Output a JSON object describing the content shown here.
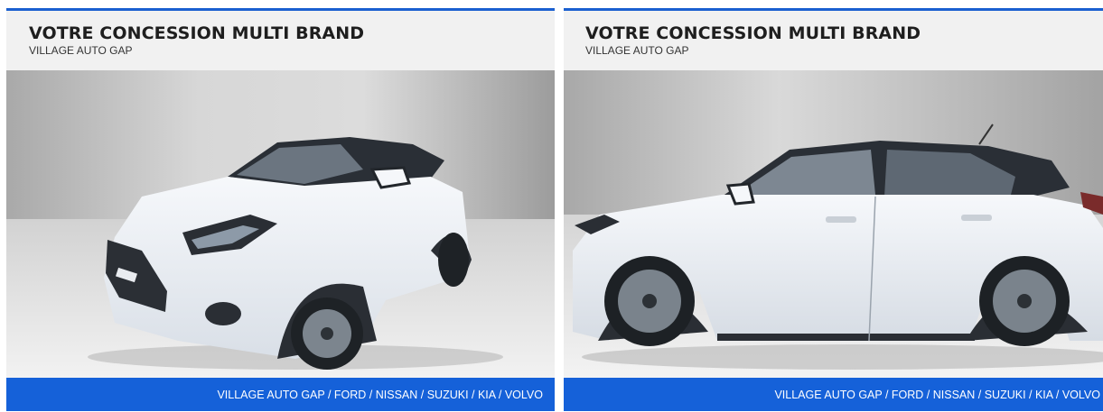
{
  "cards": [
    {
      "title": "VOTRE CONCESSION MULTI BRAND",
      "subtitle": "VILLAGE AUTO GAP",
      "photo": "white-suv-front-three-quarter",
      "footer": "VILLAGE AUTO GAP / FORD / NISSAN / SUZUKI / KIA / VOLVO"
    },
    {
      "title": "VOTRE CONCESSION MULTI BRAND",
      "subtitle": "VILLAGE AUTO GAP",
      "photo": "white-suv-side-profile",
      "footer": "VILLAGE AUTO GAP / FORD / NISSAN / SUZUKI / KIA / VOLVO"
    }
  ],
  "colors": {
    "accent_blue": "#1561d9",
    "title_text": "#1e1e1e",
    "header_bg": "#f1f1f1",
    "car_body": "#eef1f5"
  }
}
